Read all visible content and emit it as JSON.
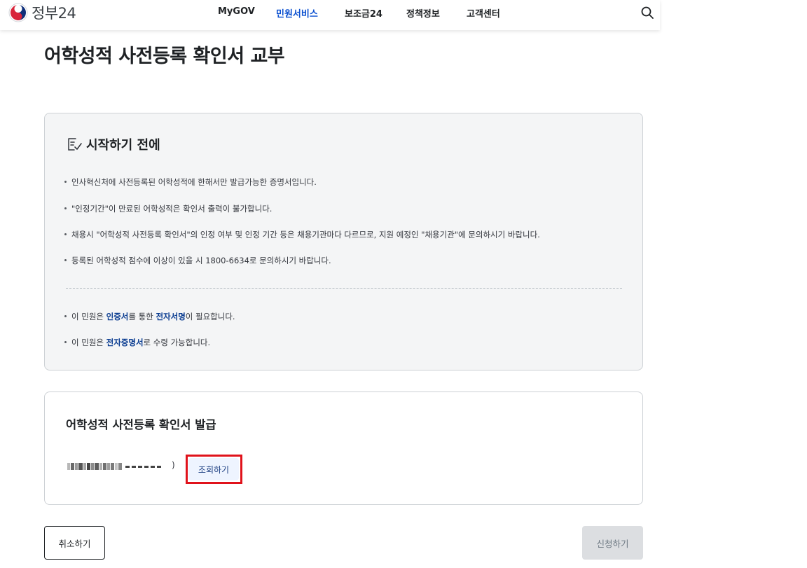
{
  "header": {
    "logo_text": "정부24",
    "nav": [
      {
        "label": "MyGOV",
        "active": false
      },
      {
        "label": "민원서비스",
        "active": true
      },
      {
        "label": "보조금24",
        "active": false
      },
      {
        "label": "정책정보",
        "active": false
      },
      {
        "label": "고객센터",
        "active": false
      }
    ],
    "search_icon": "search-icon"
  },
  "page": {
    "title": "어학성적 사전등록 확인서 교부"
  },
  "notice": {
    "heading": "시작하기 전에",
    "icon": "checklist-icon",
    "items": [
      "인사혁신처에 사전등록된 어학성적에 한해서만 발급가능한 증명서입니다.",
      "\"인정기간\"이 만료된 어학성적은 확인서 출력이 불가합니다.",
      "채용시 \"어학성적 사전등록 확인서\"의 인정 여부 및 인정 기간 등은 채용기관마다 다르므로, 지원 예정인 \"채용기관\"에 문의하시기 바랍니다.",
      "등록된 어학성적 점수에 이상이 있을 시 1800-6634로 문의하시기 바랍니다."
    ],
    "extra": {
      "cert": {
        "prefix": "이 민원은 ",
        "em1": "인증서",
        "mid": "를 통한 ",
        "em2": "전자서명",
        "suffix": "이 필요합니다."
      },
      "receipt": {
        "prefix": "이 민원은 ",
        "em": "전자증명서",
        "suffix": "로 수령 가능합니다."
      }
    }
  },
  "issue": {
    "title": "어학성적 사전등록 확인서 발급",
    "masked_suffix": ")",
    "lookup_label": "조회하기"
  },
  "actions": {
    "cancel_label": "취소하기",
    "apply_label": "신청하기"
  },
  "colors": {
    "accent": "#0b50d0",
    "emphasis": "#0b3d91",
    "highlight": "#e0121b",
    "notice_bg": "#f4f5f6"
  }
}
